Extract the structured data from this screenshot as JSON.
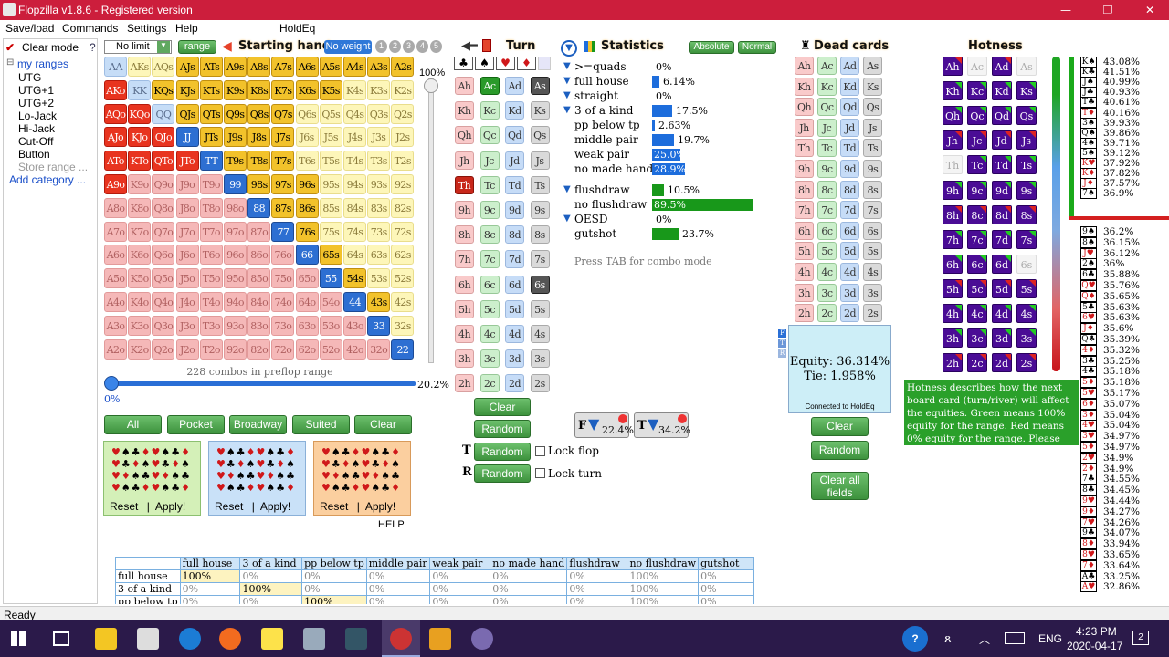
{
  "window": {
    "title": "Flopzilla v1.8.6 - Registered version",
    "minimize": "—",
    "restore": "❐",
    "close": "✕"
  },
  "menu": [
    "Save/load",
    "Commands",
    "Settings",
    "Help",
    "HoldEq"
  ],
  "left": {
    "clear_mode": "Clear mode",
    "help_q": "?",
    "tree_root": "my ranges",
    "items": [
      "UTG",
      "UTG+1",
      "UTG+2",
      "Lo-Jack",
      "Hi-Jack",
      "Cut-Off",
      "Button"
    ],
    "store": "Store range ...",
    "add": "Add category ..."
  },
  "starting": {
    "no_limit": "No limit",
    "range_btn": "range",
    "header": "Starting hand",
    "no_weight": "No weight",
    "weights": [
      "1",
      "2",
      "3",
      "4",
      "5"
    ],
    "pct_100": "100%",
    "combos": "228 combos in preflop range",
    "pct_range": "20.2%",
    "pct_zero": "0%"
  },
  "hands": [
    [
      "AA",
      "AKs",
      "AQs",
      "AJs",
      "ATs",
      "A9s",
      "A8s",
      "A7s",
      "A6s",
      "A5s",
      "A4s",
      "A3s",
      "A2s"
    ],
    [
      "AKo",
      "KK",
      "KQs",
      "KJs",
      "KTs",
      "K9s",
      "K8s",
      "K7s",
      "K6s",
      "K5s",
      "K4s",
      "K3s",
      "K2s"
    ],
    [
      "AQo",
      "KQo",
      "QQ",
      "QJs",
      "QTs",
      "Q9s",
      "Q8s",
      "Q7s",
      "Q6s",
      "Q5s",
      "Q4s",
      "Q3s",
      "Q2s"
    ],
    [
      "AJo",
      "KJo",
      "QJo",
      "JJ",
      "JTs",
      "J9s",
      "J8s",
      "J7s",
      "J6s",
      "J5s",
      "J4s",
      "J3s",
      "J2s"
    ],
    [
      "ATo",
      "KTo",
      "QTo",
      "JTo",
      "TT",
      "T9s",
      "T8s",
      "T7s",
      "T6s",
      "T5s",
      "T4s",
      "T3s",
      "T2s"
    ],
    [
      "A9o",
      "K9o",
      "Q9o",
      "J9o",
      "T9o",
      "99",
      "98s",
      "97s",
      "96s",
      "95s",
      "94s",
      "93s",
      "92s"
    ],
    [
      "A8o",
      "K8o",
      "Q8o",
      "J8o",
      "T8o",
      "98o",
      "88",
      "87s",
      "86s",
      "85s",
      "84s",
      "83s",
      "82s"
    ],
    [
      "A7o",
      "K7o",
      "Q7o",
      "J7o",
      "T7o",
      "97o",
      "87o",
      "77",
      "76s",
      "75s",
      "74s",
      "73s",
      "72s"
    ],
    [
      "A6o",
      "K6o",
      "Q6o",
      "J6o",
      "T6o",
      "96o",
      "86o",
      "76o",
      "66",
      "65s",
      "64s",
      "63s",
      "62s"
    ],
    [
      "A5o",
      "K5o",
      "Q5o",
      "J5o",
      "T5o",
      "95o",
      "85o",
      "75o",
      "65o",
      "55",
      "54s",
      "53s",
      "52s"
    ],
    [
      "A4o",
      "K4o",
      "Q4o",
      "J4o",
      "T4o",
      "94o",
      "84o",
      "74o",
      "64o",
      "54o",
      "44",
      "43s",
      "42s"
    ],
    [
      "A3o",
      "K3o",
      "Q3o",
      "J3o",
      "T3o",
      "93o",
      "83o",
      "73o",
      "63o",
      "53o",
      "43o",
      "33",
      "32s"
    ],
    [
      "A2o",
      "K2o",
      "Q2o",
      "J2o",
      "T2o",
      "92o",
      "82o",
      "72o",
      "62o",
      "52o",
      "42o",
      "32o",
      "22"
    ]
  ],
  "selected_hands": [
    "AKo",
    "AQo",
    "KQo",
    "AJo",
    "KJo",
    "QJo",
    "ATo",
    "KTo",
    "QTo",
    "JTo",
    "A9o",
    "KQs",
    "KJs",
    "KTs",
    "K9s",
    "K8s",
    "K7s",
    "K6s",
    "K5s",
    "QJs",
    "QTs",
    "Q9s",
    "Q8s",
    "Q7s",
    "JTs",
    "J9s",
    "J8s",
    "J7s",
    "T9s",
    "T8s",
    "T7s",
    "98s",
    "97s",
    "96s",
    "87s",
    "86s",
    "76s",
    "65s",
    "54s",
    "43s",
    "AJs",
    "ATs",
    "A9s",
    "A8s",
    "A7s",
    "A6s",
    "A5s",
    "A4s",
    "A3s",
    "A2s",
    "JJ",
    "TT",
    "99",
    "88",
    "77",
    "66",
    "55",
    "44",
    "33",
    "22"
  ],
  "quick_buttons": [
    "All",
    "Pocket",
    "Broadway",
    "Suited",
    "Clear"
  ],
  "suit_boxes": [
    {
      "reset": "Reset",
      "sep": "|",
      "apply": "Apply!"
    },
    {
      "reset": "Reset",
      "sep": "|",
      "apply": "Apply!"
    },
    {
      "reset": "Reset",
      "sep": "|",
      "apply": "Apply!"
    }
  ],
  "help_label": "HELP",
  "turn": {
    "header": "Turn",
    "suits": [
      "♣",
      "♠",
      "♥",
      "♦"
    ],
    "cards": [
      [
        "Ah",
        "Ac",
        "Ad",
        "As"
      ],
      [
        "Kh",
        "Kc",
        "Kd",
        "Ks"
      ],
      [
        "Qh",
        "Qc",
        "Qd",
        "Qs"
      ],
      [
        "Jh",
        "Jc",
        "Jd",
        "Js"
      ],
      [
        "Th",
        "Tc",
        "Td",
        "Ts"
      ],
      [
        "9h",
        "9c",
        "9d",
        "9s"
      ],
      [
        "8h",
        "8c",
        "8d",
        "8s"
      ],
      [
        "7h",
        "7c",
        "7d",
        "7s"
      ],
      [
        "6h",
        "6c",
        "6d",
        "6s"
      ],
      [
        "5h",
        "5c",
        "5d",
        "5s"
      ],
      [
        "4h",
        "4c",
        "4d",
        "4s"
      ],
      [
        "3h",
        "3c",
        "3d",
        "3s"
      ],
      [
        "2h",
        "2c",
        "2d",
        "2s"
      ]
    ],
    "clear": "Clear",
    "random": "Random",
    "t_random": "Random",
    "r_random": "Random",
    "lock_flop": "Lock flop",
    "lock_turn": "Lock turn",
    "t_label": "T",
    "r_label": "R"
  },
  "stats": {
    "header": "Statistics",
    "absolute": "Absolute",
    "normal": "Normal",
    "rows": [
      {
        "label": ">=quads",
        "pct": "0%",
        "value": 0
      },
      {
        "label": "full house",
        "pct": "6.14%",
        "value": 6.14
      },
      {
        "label": "straight",
        "pct": "0%",
        "value": 0
      },
      {
        "label": "3 of a kind",
        "pct": "17.5%",
        "value": 17.5
      },
      {
        "label": "pp below tp",
        "pct": "2.63%",
        "value": 2.63
      },
      {
        "label": "middle pair",
        "pct": "19.7%",
        "value": 19.7
      },
      {
        "label": "weak pair",
        "pct": "25.0%",
        "value": 25.0
      },
      {
        "label": "no made hand",
        "pct": "28.9%",
        "value": 28.9
      }
    ],
    "draws": [
      {
        "label": "flushdraw",
        "pct": "10.5%",
        "value": 10.5
      },
      {
        "label": "no flushdraw",
        "pct": "89.5%",
        "value": 89.5
      },
      {
        "label": "OESD",
        "pct": "0%",
        "value": 0
      },
      {
        "label": "gutshot",
        "pct": "23.7%",
        "value": 23.7
      }
    ],
    "tab_hint": "Press TAB for combo mode",
    "filter_f": "22.4%",
    "filter_t": "34.2%"
  },
  "dead": {
    "header": "Dead cards",
    "cards": [
      [
        "Ah",
        "Ac",
        "Ad",
        "As"
      ],
      [
        "Kh",
        "Kc",
        "Kd",
        "Ks"
      ],
      [
        "Qh",
        "Qc",
        "Qd",
        "Qs"
      ],
      [
        "Jh",
        "Jc",
        "Jd",
        "Js"
      ],
      [
        "Th",
        "Tc",
        "Td",
        "Ts"
      ],
      [
        "9h",
        "9c",
        "9d",
        "9s"
      ],
      [
        "8h",
        "8c",
        "8d",
        "8s"
      ],
      [
        "7h",
        "7c",
        "7d",
        "7s"
      ],
      [
        "6h",
        "6c",
        "6d",
        "6s"
      ],
      [
        "5h",
        "5c",
        "5d",
        "5s"
      ],
      [
        "4h",
        "4c",
        "4d",
        "4s"
      ],
      [
        "3h",
        "3c",
        "3d",
        "3s"
      ],
      [
        "2h",
        "2c",
        "2d",
        "2s"
      ]
    ],
    "clear": "Clear",
    "random": "Random",
    "clear_all": "Clear all fields"
  },
  "equity": {
    "equity": "Equity: 36.314%",
    "tie": "Tie: 1.958%",
    "connected": "Connected to HoldEq"
  },
  "hotness": {
    "header": "Hotness",
    "cards": [
      [
        "Ah",
        "Ac",
        "Ad",
        "As"
      ],
      [
        "Kh",
        "Kc",
        "Kd",
        "Ks"
      ],
      [
        "Qh",
        "Qc",
        "Qd",
        "Qs"
      ],
      [
        "Jh",
        "Jc",
        "Jd",
        "Js"
      ],
      [
        "Th",
        "Tc",
        "Td",
        "Ts"
      ],
      [
        "9h",
        "9c",
        "9d",
        "9s"
      ],
      [
        "8h",
        "8c",
        "8d",
        "8s"
      ],
      [
        "7h",
        "7c",
        "7d",
        "7s"
      ],
      [
        "6h",
        "6c",
        "6d",
        "6s"
      ],
      [
        "5h",
        "5c",
        "5d",
        "5s"
      ],
      [
        "4h",
        "4c",
        "4d",
        "4s"
      ],
      [
        "3h",
        "3c",
        "3d",
        "3s"
      ],
      [
        "2h",
        "2c",
        "2d",
        "2s"
      ]
    ],
    "tooltip": "Hotness describes how the next board card (turn/river) will affect the equities. Green means 100% equity for the range. Red means 0% equity for the range. Please read the online manual for more details."
  },
  "hot_list": [
    {
      "card": "K♠",
      "v": "43.08%"
    },
    {
      "card": "K♣",
      "v": "41.51%"
    },
    {
      "card": "J♠",
      "v": "40.99%"
    },
    {
      "card": "J♣",
      "v": "40.93%"
    },
    {
      "card": "T♣",
      "v": "40.61%"
    },
    {
      "card": "T♦",
      "v": "40.16%"
    },
    {
      "card": "3♠",
      "v": "39.93%"
    },
    {
      "card": "Q♠",
      "v": "39.86%"
    },
    {
      "card": "4♠",
      "v": "39.71%"
    },
    {
      "card": "5♠",
      "v": "39.12%"
    },
    {
      "card": "K♥",
      "v": "37.92%"
    },
    {
      "card": "K♦",
      "v": "37.82%"
    },
    {
      "card": "J♦",
      "v": "37.57%"
    },
    {
      "card": "7♠",
      "v": "36.9%"
    },
    {
      "card": "9♠",
      "v": "36.2%"
    },
    {
      "card": "8♠",
      "v": "36.15%"
    },
    {
      "card": "J♥",
      "v": "36.12%"
    },
    {
      "card": "2♠",
      "v": "36%"
    },
    {
      "card": "6♣",
      "v": "35.88%"
    },
    {
      "card": "Q♥",
      "v": "35.76%"
    },
    {
      "card": "Q♦",
      "v": "35.65%"
    },
    {
      "card": "5♣",
      "v": "35.63%"
    },
    {
      "card": "6♥",
      "v": "35.63%"
    },
    {
      "card": "J♦",
      "v": "35.6%"
    },
    {
      "card": "Q♣",
      "v": "35.39%"
    },
    {
      "card": "4♦",
      "v": "35.32%"
    },
    {
      "card": "3♣",
      "v": "35.25%"
    },
    {
      "card": "4♣",
      "v": "35.18%"
    },
    {
      "card": "5♦",
      "v": "35.18%"
    },
    {
      "card": "5♥",
      "v": "35.17%"
    },
    {
      "card": "6♦",
      "v": "35.07%"
    },
    {
      "card": "3♦",
      "v": "35.04%"
    },
    {
      "card": "4♥",
      "v": "35.04%"
    },
    {
      "card": "3♥",
      "v": "34.97%"
    },
    {
      "card": "5♦",
      "v": "34.97%"
    },
    {
      "card": "2♥",
      "v": "34.9%"
    },
    {
      "card": "2♦",
      "v": "34.9%"
    },
    {
      "card": "7♣",
      "v": "34.55%"
    },
    {
      "card": "8♣",
      "v": "34.45%"
    },
    {
      "card": "9♥",
      "v": "34.44%"
    },
    {
      "card": "9♦",
      "v": "34.27%"
    },
    {
      "card": "7♥",
      "v": "34.26%"
    },
    {
      "card": "9♣",
      "v": "34.07%"
    },
    {
      "card": "8♦",
      "v": "33.94%"
    },
    {
      "card": "8♥",
      "v": "33.65%"
    },
    {
      "card": "7♦",
      "v": "33.64%"
    },
    {
      "card": "A♣",
      "v": "33.25%"
    },
    {
      "card": "A♥",
      "v": "32.86%"
    }
  ],
  "bottom_table": {
    "headers": [
      "",
      "full house",
      "3 of a kind",
      "pp below tp",
      "middle pair",
      "weak pair",
      "no made hand",
      "flushdraw",
      "no flushdraw",
      "gutshot"
    ],
    "rows": [
      [
        "full house",
        "100%",
        "0%",
        "0%",
        "0%",
        "0%",
        "0%",
        "0%",
        "100%",
        "0%"
      ],
      [
        "3 of a kind",
        "0%",
        "100%",
        "0%",
        "0%",
        "0%",
        "0%",
        "0%",
        "100%",
        "0%"
      ],
      [
        "pp below tp",
        "0%",
        "0%",
        "100%",
        "0%",
        "0%",
        "0%",
        "0%",
        "100%",
        "0%"
      ]
    ]
  },
  "status": "Ready",
  "taskbar": {
    "time": "4:23 PM",
    "date": "2020-04-17",
    "lang": "ENG",
    "notif": "2"
  },
  "colors": {
    "title": "#cc1e3c",
    "accent_blue": "#1d6ddc",
    "accent_green": "#18981a",
    "hot_purple": "#4a0c95"
  }
}
